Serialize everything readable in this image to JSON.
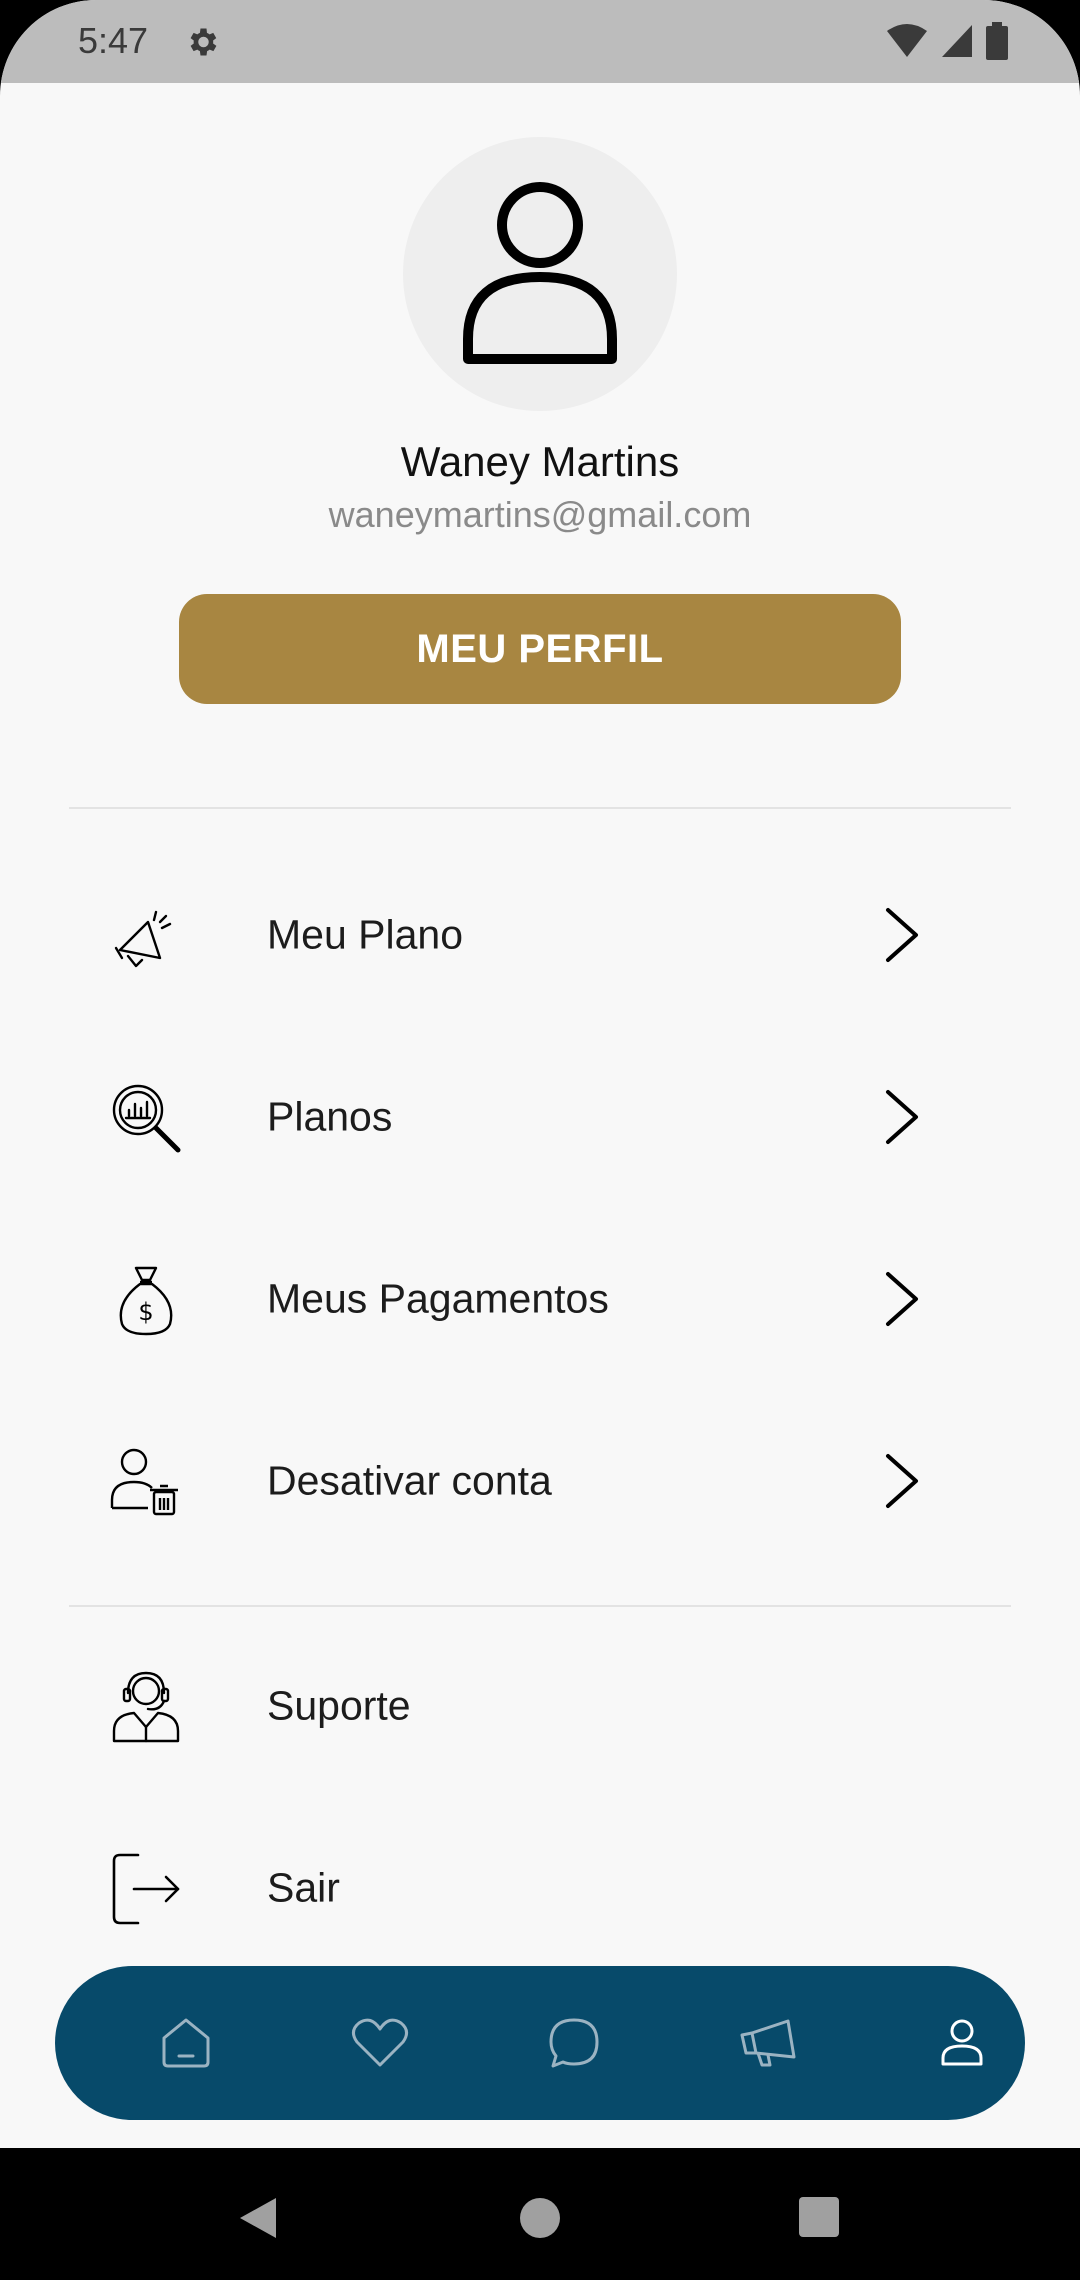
{
  "status_bar": {
    "time": "5:47"
  },
  "profile": {
    "name": "Waney Martins",
    "email": "waneymartins@gmail.com",
    "button_label": "MEU PERFIL"
  },
  "menu": {
    "items": [
      {
        "label": "Meu Plano",
        "icon": "megaphone-icon"
      },
      {
        "label": "Planos",
        "icon": "magnifier-chart-icon"
      },
      {
        "label": "Meus Pagamentos",
        "icon": "money-bag-icon"
      },
      {
        "label": "Desativar conta",
        "icon": "user-delete-icon"
      }
    ],
    "secondary": [
      {
        "label": "Suporte",
        "icon": "support-agent-icon"
      },
      {
        "label": "Sair",
        "icon": "logout-icon"
      }
    ]
  },
  "bottom_nav": {
    "items": [
      "home-icon",
      "heart-icon",
      "chat-icon",
      "megaphone-icon",
      "user-icon"
    ],
    "active": "user-icon"
  },
  "colors": {
    "accent": "#a88641",
    "nav_bg": "#074a6a",
    "background": "#f8f8f8"
  }
}
